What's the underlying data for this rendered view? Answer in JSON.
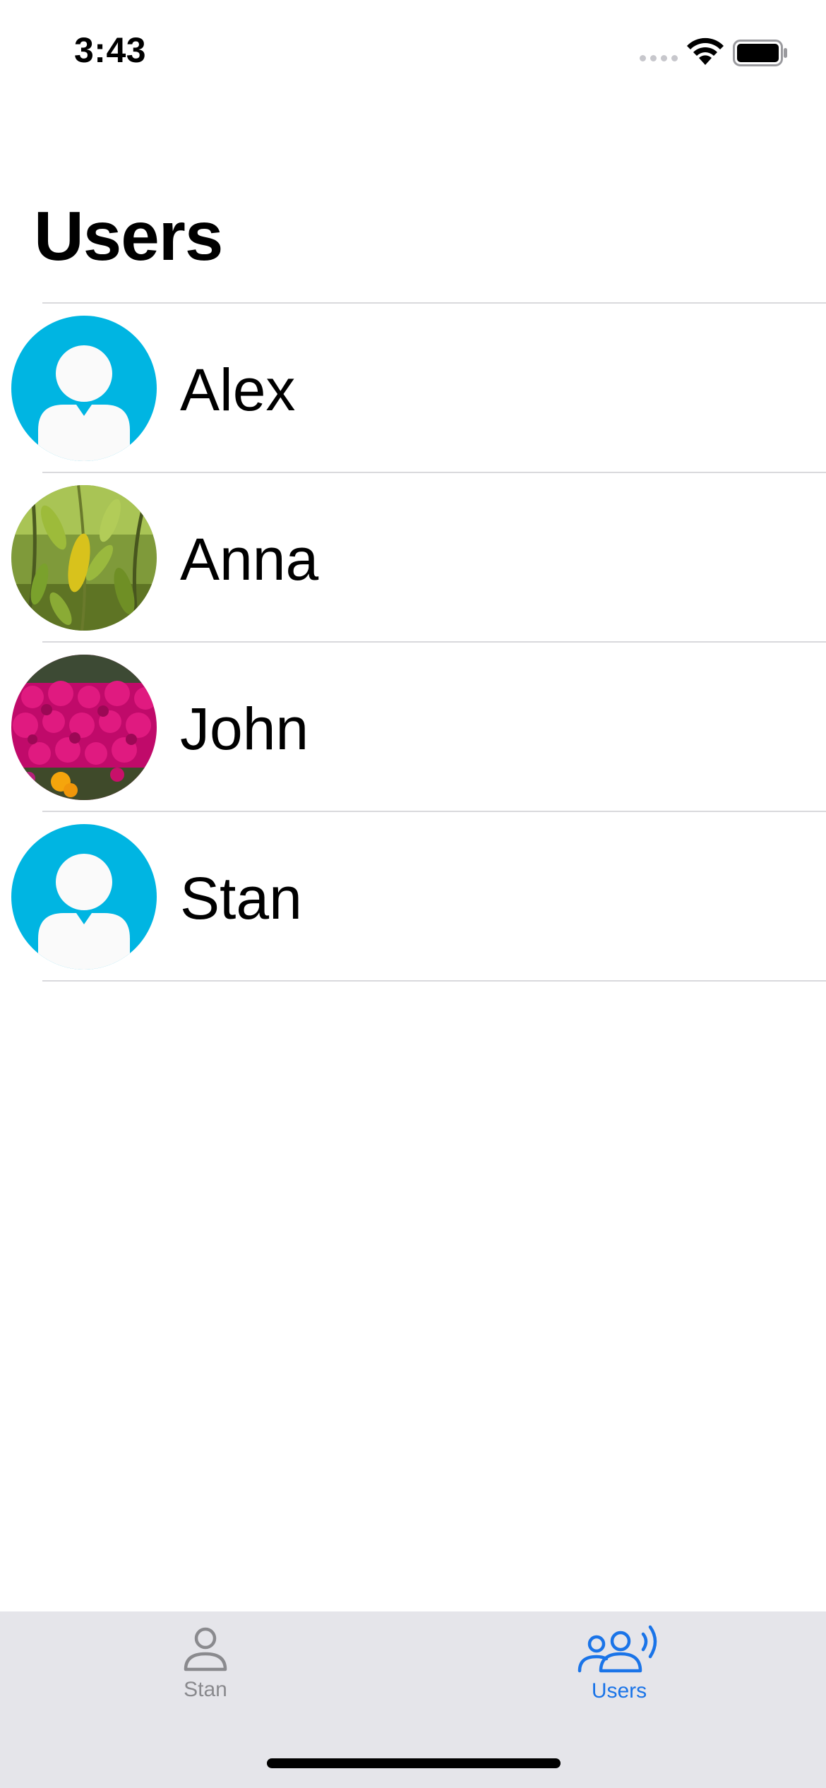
{
  "status_bar": {
    "time": "3:43"
  },
  "header": {
    "title": "Users"
  },
  "users": [
    {
      "name": "Alex",
      "avatar": "default-person-avatar"
    },
    {
      "name": "Anna",
      "avatar": "leaves-photo"
    },
    {
      "name": "John",
      "avatar": "flowers-photo"
    },
    {
      "name": "Stan",
      "avatar": "default-person-avatar"
    }
  ],
  "tab_bar": {
    "tabs": [
      {
        "label": "Stan",
        "icon": "person-icon",
        "selected": false
      },
      {
        "label": "Users",
        "icon": "people-wave-icon",
        "selected": true
      }
    ]
  },
  "colors": {
    "accent": "#1a74e8",
    "avatar_default_bg": "#00b5e2",
    "tab_inactive": "#8a8a8e",
    "tab_bar_bg": "#e5e5ea"
  }
}
